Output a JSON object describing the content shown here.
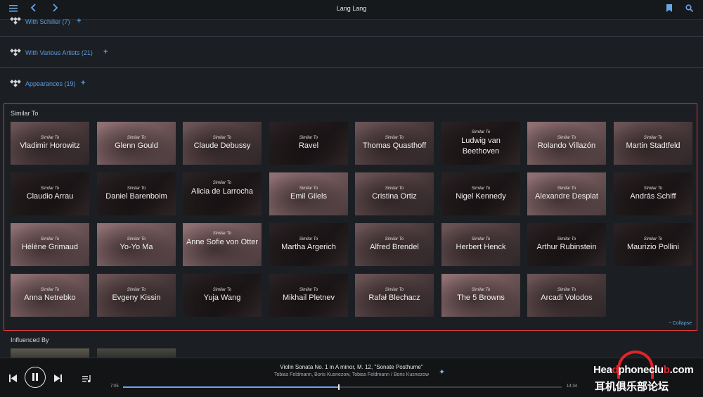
{
  "header": {
    "title": "Lang Lang"
  },
  "sections": [
    {
      "label": "With Schiller (7)"
    },
    {
      "label": "With Various Artists (21)"
    },
    {
      "label": "Appearances (19)"
    }
  ],
  "similar": {
    "title": "Similar To",
    "subtitle": "Similar To",
    "collapse_label": "− Collapse",
    "artists": [
      "Vladimir Horowitz",
      "Glenn Gould",
      "Claude Debussy",
      "Ravel",
      "Thomas Quasthoff",
      "Ludwig van Beethoven",
      "Rolando Villazón",
      "Martin Stadtfeld",
      "Claudio Arrau",
      "Daniel Barenboim",
      "Alicia de Larrocha",
      "Emil Gilels",
      "Cristina Ortiz",
      "Nigel Kennedy",
      "Alexandre Desplat",
      "András Schiff",
      "Hélène Grimaud",
      "Yo-Yo Ma",
      "Anne Sofie von Otter",
      "Martha Argerich",
      "Alfred Brendel",
      "Herbert Henck",
      "Arthur Rubinstein",
      "Maurizio Pollini",
      "Anna Netrebko",
      "Evgeny Kissin",
      "Yuja Wang",
      "Mikhail Pletnev",
      "Rafał Blechacz",
      "The 5 Browns",
      "Arcadi Volodos"
    ]
  },
  "influenced": {
    "title": "Influenced By"
  },
  "player": {
    "track_title": "Violin Sonata No. 1 in A minor, M. 12, \"Sonate Posthume\"",
    "track_artists": "Tobias Feldmann, Boris Kusnezow, Tobias Feldmann / Boris Kusnezow",
    "elapsed": "7:05",
    "duration": "14:34",
    "progress_fraction": 0.49
  },
  "watermark": {
    "line1_a": "Hea",
    "line1_o": "d",
    "line1_b": "phoneclu",
    "line1_c": "b",
    "line1_d": ".com",
    "line2": "耳机俱乐部论坛"
  },
  "colors": {
    "accent": "#6aa5e8",
    "highlight_border": "#d93a3a"
  }
}
